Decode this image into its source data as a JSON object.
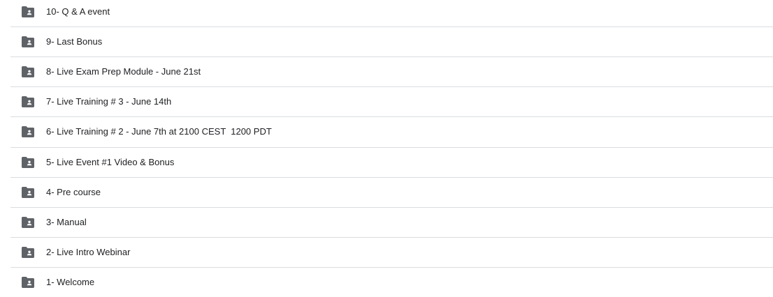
{
  "folders": [
    {
      "name": "10- Q & A event",
      "icon": "shared-folder-icon"
    },
    {
      "name": "9- Last Bonus",
      "icon": "shared-folder-icon"
    },
    {
      "name": "8- Live Exam Prep Module - June 21st",
      "icon": "shared-folder-icon"
    },
    {
      "name": "7- Live Training # 3 - June 14th",
      "icon": "shared-folder-icon"
    },
    {
      "name": "6- Live Training # 2 - June 7th at 2100 CEST  1200 PDT",
      "icon": "shared-folder-icon"
    },
    {
      "name": "5- Live Event #1 Video & Bonus",
      "icon": "shared-folder-icon"
    },
    {
      "name": "4- Pre course",
      "icon": "shared-folder-icon"
    },
    {
      "name": "3- Manual",
      "icon": "shared-folder-icon"
    },
    {
      "name": "2- Live Intro Webinar",
      "icon": "shared-folder-icon"
    },
    {
      "name": "1- Welcome",
      "icon": "shared-folder-icon"
    }
  ],
  "colors": {
    "folder_icon": "#5f6368",
    "text": "#202124",
    "divider": "#dadce0"
  }
}
